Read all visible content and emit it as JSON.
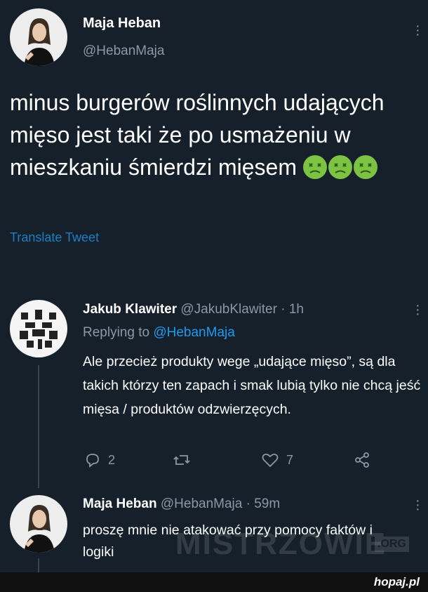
{
  "tweet": {
    "author_name": "Maja Heban",
    "author_handle": "@HebanMaja",
    "text": "minus burgerów roślinnych udających mięso jest taki że po usmażeniu w mieszkaniu śmierdzi mięsem",
    "emoji": [
      "nauseated-face",
      "nauseated-face",
      "nauseated-face"
    ],
    "translate_label": "Translate Tweet"
  },
  "reply1": {
    "author_name": "Jakub Klawiter",
    "author_handle": "@JakubKlawiter",
    "time": "· 1h",
    "replying_prefix": "Replying to",
    "replying_handle": "@HebanMaja",
    "text": "Ale przecież produkty wege „udające mięso”, są dla takich którzy ten zapach i smak lubią tylko nie chcą jeść mięsa / produktów odzwierzęcych.",
    "reply_count": "2",
    "retweet_count": "",
    "like_count": "7"
  },
  "reply2": {
    "author_name": "Maja Heban",
    "author_handle": "@HebanMaja",
    "time": "· 59m",
    "text": "proszę mnie nie atakować przy pomocy faktów i logiki"
  },
  "watermarks": {
    "mistrzowie": "MISTRZOWIE",
    "org": ".ORG",
    "hopaj": "hopaj.pl"
  },
  "colors": {
    "background": "#15202b",
    "accent": "#1d9bf0",
    "muted": "#8b98a5",
    "footer": "#111111"
  }
}
